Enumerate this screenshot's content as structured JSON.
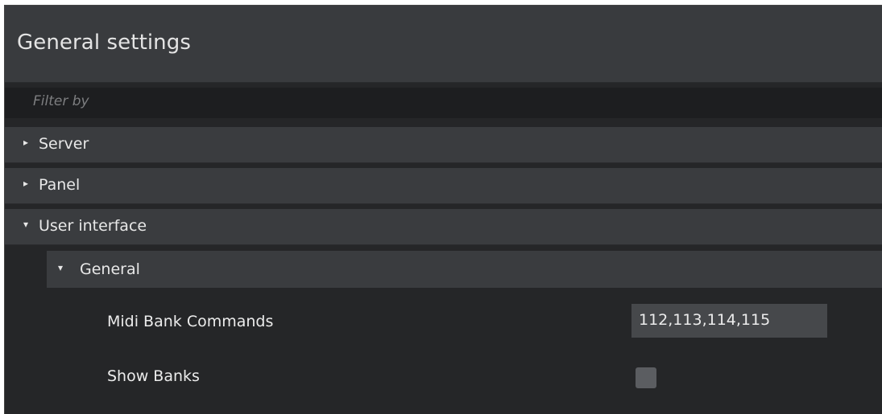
{
  "window": {
    "title": "General settings"
  },
  "filter": {
    "placeholder": "Filter by",
    "value": ""
  },
  "sections": [
    {
      "label": "Server",
      "expanded": false,
      "arrow": "▸"
    },
    {
      "label": "Panel",
      "expanded": false,
      "arrow": "▸"
    },
    {
      "label": "User interface",
      "expanded": true,
      "arrow": "▾"
    }
  ],
  "user_interface": {
    "general": {
      "label": "General",
      "arrow": "▾",
      "expanded": true,
      "settings": [
        {
          "label": "Midi Bank Commands",
          "type": "text",
          "value": "112,113,114,115"
        },
        {
          "label": "Show Banks",
          "type": "checkbox",
          "checked": false
        }
      ]
    }
  },
  "colors": {
    "panel_background": "#252628",
    "header_background": "#393b3e",
    "filter_background": "#1d1e20",
    "field_background": "#46484b",
    "text": "#e8e8e8",
    "placeholder": "#7d7e80"
  }
}
